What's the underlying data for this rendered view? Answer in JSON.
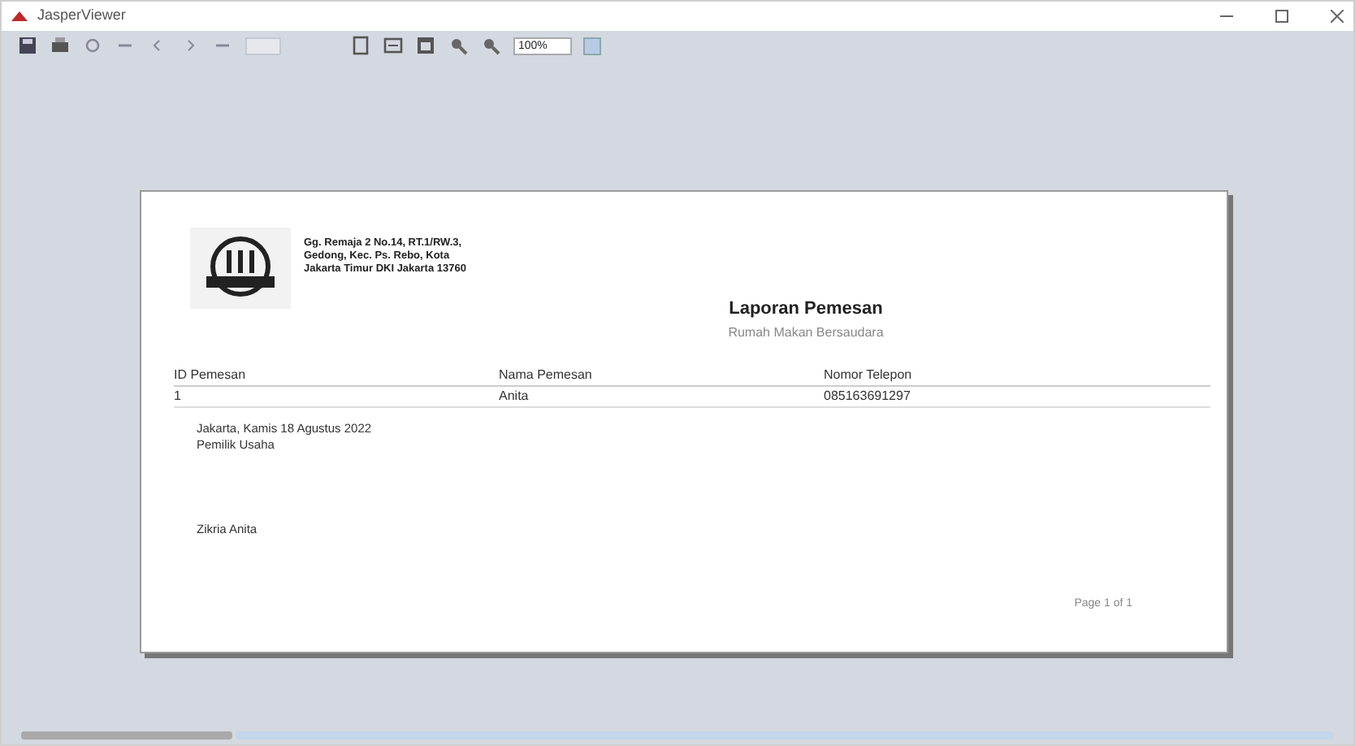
{
  "window": {
    "title": "JasperViewer"
  },
  "toolbar": {
    "zoom": "100%"
  },
  "report": {
    "address": [
      "Gg. Remaja 2 No.14, RT.1/RW.3,",
      "Gedong, Kec. Ps. Rebo, Kota",
      "Jakarta Timur DKI Jakarta 13760"
    ],
    "title": "Laporan Pemesan",
    "subtitle": "Rumah Makan Bersaudara",
    "columns": [
      "ID Pemesan",
      "Nama Pemesan",
      "Nomor Telepon"
    ],
    "rows": [
      [
        "1",
        "Anita",
        "085163691297"
      ]
    ],
    "place_date": "Jakarta, Kamis 18 Agustus 2022",
    "role": "Pemilik Usaha",
    "signer": "Zikria Anita",
    "page_footer": "Page 1 of 1"
  }
}
